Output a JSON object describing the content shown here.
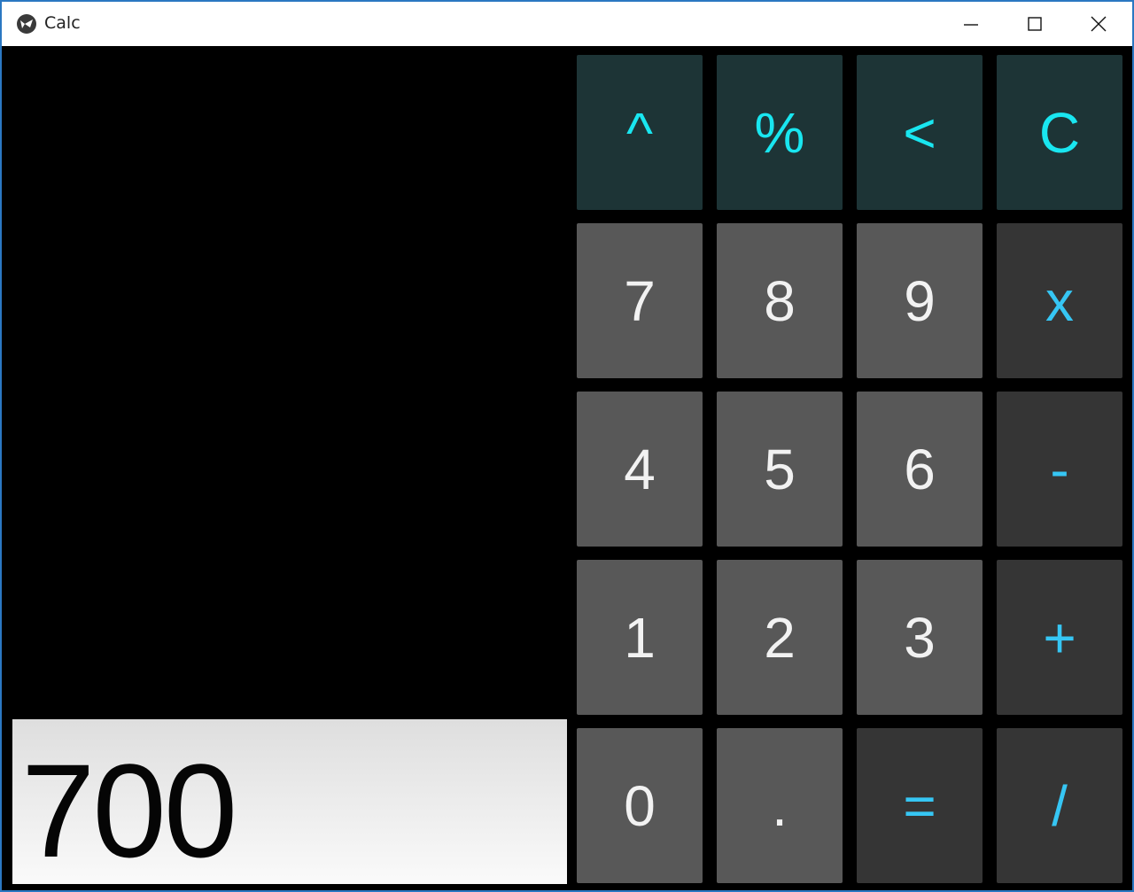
{
  "window": {
    "title": "Calc",
    "icon": "kivy-logo-icon",
    "controls": [
      "minimize-icon",
      "maximize-icon",
      "close-icon"
    ]
  },
  "display": {
    "value": "700"
  },
  "keys": {
    "row1": [
      "^",
      "%",
      "<",
      "C"
    ],
    "row2": [
      "7",
      "8",
      "9",
      "x"
    ],
    "row3": [
      "4",
      "5",
      "6",
      "-"
    ],
    "row4": [
      "1",
      "2",
      "3",
      "+"
    ],
    "row5": [
      "0",
      ".",
      "=",
      "/"
    ]
  },
  "colors": {
    "function_key_bg": "#1d3436",
    "function_key_text": "#19e6f0",
    "number_key_bg": "#585858",
    "number_key_text": "#f2f2f2",
    "operator_key_bg": "#353535",
    "operator_key_text": "#36c6f4",
    "window_border": "#2b78c2"
  }
}
